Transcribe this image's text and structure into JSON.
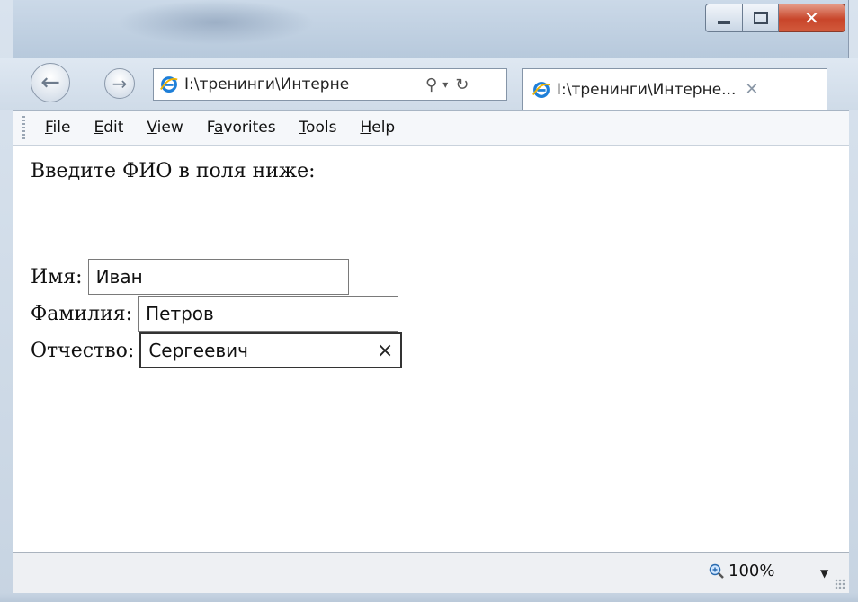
{
  "window": {
    "caption_buttons": {
      "minimize": "minimize",
      "maximize": "maximize",
      "close": "close"
    }
  },
  "nav": {
    "address": "I:\\тренинги\\Интерне",
    "tab_title": "I:\\тренинги\\Интерне...",
    "icons": [
      "back-arrow-icon",
      "forward-arrow-icon",
      "ie-logo-icon",
      "search-icon",
      "dropdown-icon",
      "refresh-icon",
      "tab-close-icon"
    ]
  },
  "menu": {
    "items": [
      {
        "label": "File",
        "access": "F"
      },
      {
        "label": "Edit",
        "access": "E"
      },
      {
        "label": "View",
        "access": "V"
      },
      {
        "label": "Favorites",
        "access": "a"
      },
      {
        "label": "Tools",
        "access": "T"
      },
      {
        "label": "Help",
        "access": "H"
      }
    ]
  },
  "content": {
    "heading": "Введите ФИО в поля ниже:",
    "fields": [
      {
        "label": "Имя:",
        "value": "Иван"
      },
      {
        "label": "Фамилия:",
        "value": "Петров"
      },
      {
        "label": "Отчество:",
        "value": "Сергеевич",
        "clear": "×"
      }
    ]
  },
  "status": {
    "zoom": "100%"
  },
  "colors": {
    "frame": "#cfdbe8",
    "close_button": "#c8452a",
    "ie_logo": "#1e7fd8"
  }
}
